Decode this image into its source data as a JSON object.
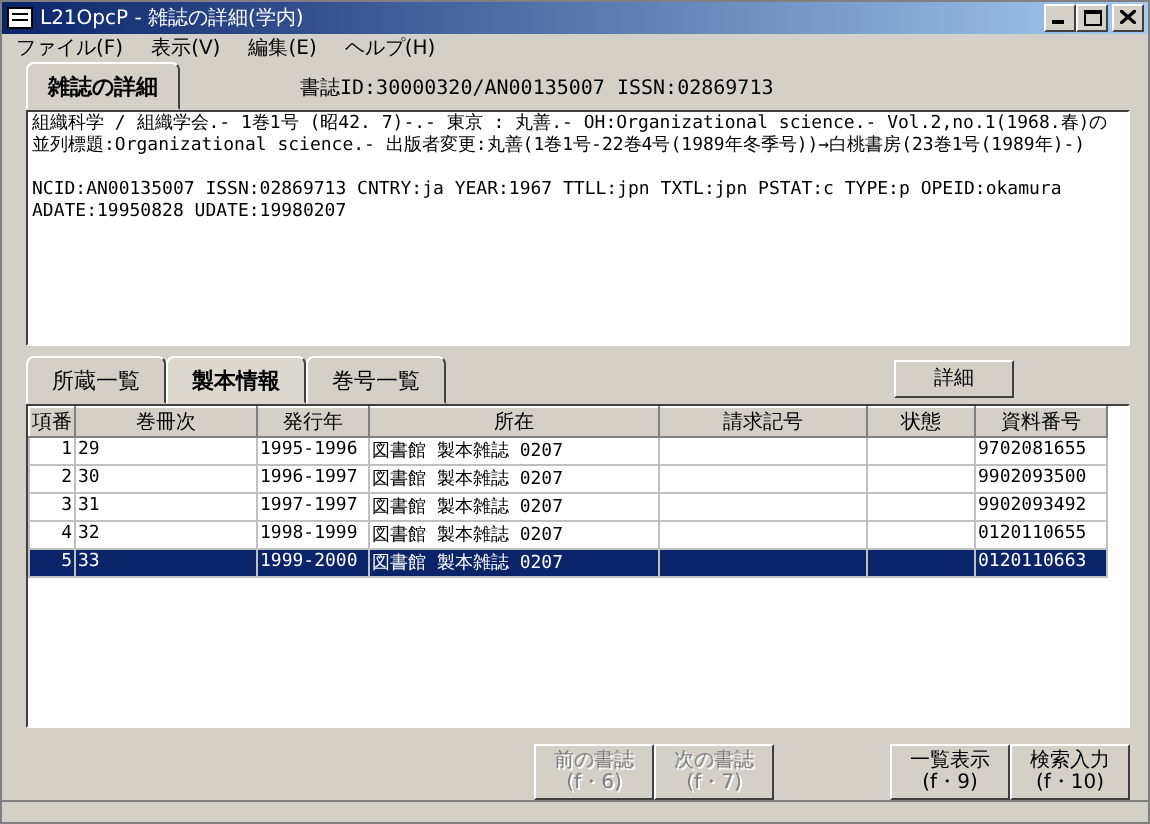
{
  "window": {
    "title": "L21OpcP - 雑誌の詳細(学内)"
  },
  "menu": [
    {
      "label": "ファイル(F)"
    },
    {
      "label": "表示(V)"
    },
    {
      "label": "編集(E)"
    },
    {
      "label": "ヘルプ(H)"
    }
  ],
  "header": {
    "tab": {
      "label": "雑誌の詳細",
      "selected": true
    },
    "record_id": "書誌ID:30000320/AN00135007 ISSN:02869713"
  },
  "details": [
    "組織科学 / 組織学会.- 1巻1号 (昭42. 7)-.- 東京 : 丸善.- OH:Organizational science.- Vol.2,no.1(1968.春)の並列標題:Organizational science.- 出版者変更:丸善(1巻1号-22巻4号(1989年冬季号))→白桃書房(23巻1号(1989年)-)",
    "NCID:AN00135007 ISSN:02869713 CNTRY:ja YEAR:1967 TTLL:jpn TXTL:jpn PSTAT:c TYPE:p OPEID:okamura ADATE:19950828 UDATE:19980207"
  ],
  "tabs": [
    {
      "label": "所蔵一覧",
      "selected": false
    },
    {
      "label": "製本情報",
      "selected": true
    },
    {
      "label": "巻号一覧",
      "selected": false
    }
  ],
  "detail_button": "詳細",
  "table": {
    "columns": [
      "項番",
      "巻冊次",
      "発行年",
      "所在",
      "請求記号",
      "状態",
      "資料番号"
    ],
    "rows": [
      {
        "no": "1",
        "volume": "29",
        "years": "1995-1996",
        "location": "図書館 製本雑誌 0207",
        "material_no": "9702081655",
        "selected": false
      },
      {
        "no": "2",
        "volume": "30",
        "years": "1996-1997",
        "location": "図書館 製本雑誌 0207",
        "material_no": "9902093500",
        "selected": false
      },
      {
        "no": "3",
        "volume": "31",
        "years": "1997-1997",
        "location": "図書館 製本雑誌 0207",
        "material_no": "9902093492",
        "selected": false
      },
      {
        "no": "4",
        "volume": "32",
        "years": "1998-1999",
        "location": "図書館 製本雑誌 0207",
        "material_no": "0120110655",
        "selected": false
      },
      {
        "no": "5",
        "volume": "33",
        "years": "1999-2000",
        "location": "図書館 製本雑誌 0207",
        "material_no": "0120110663",
        "selected": true
      }
    ]
  },
  "buttons": [
    {
      "label": "前の書誌",
      "key": "(f・6)",
      "disabled": true
    },
    {
      "label": "次の書誌",
      "key": "(f・7)",
      "disabled": true
    },
    {
      "label": "一覧表示",
      "key": "(f・9)",
      "disabled": false
    },
    {
      "label": "検索入力",
      "key": "(f・10)",
      "disabled": false
    }
  ]
}
